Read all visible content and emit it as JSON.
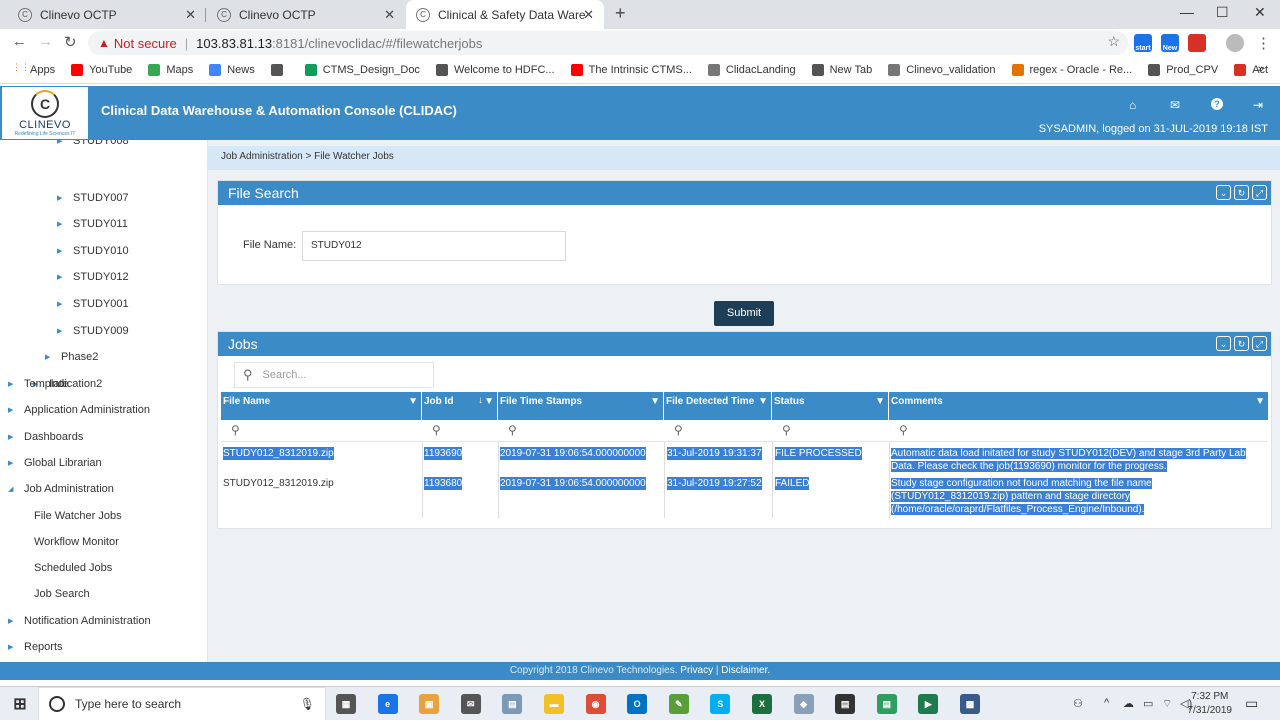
{
  "browser": {
    "tabs": [
      {
        "title": "Clinevo OCTP"
      },
      {
        "title": "Clinevo OCTP"
      },
      {
        "title": "Clinical & Safety Data Warehouse"
      }
    ],
    "new_tab": "+",
    "not_secure": "Not secure",
    "url_host": "103.83.81.13",
    "url_path": ":8181/clinevoclidac/#/filewatcherjobs",
    "extensions": [
      {
        "label": "start",
        "color": "#1a73e8"
      },
      {
        "label": "New",
        "color": "#1a73e8"
      },
      {
        "label": "",
        "color": "#d93025"
      }
    ],
    "bookmarks": [
      {
        "label": "Apps",
        "color": "#e37400"
      },
      {
        "label": "YouTube",
        "color": "#ff0000"
      },
      {
        "label": "Maps",
        "color": "#34a853"
      },
      {
        "label": "News",
        "color": "#4285f4"
      },
      {
        "label": "",
        "color": "#555555"
      },
      {
        "label": "CTMS_Design_Doc",
        "color": "#0f9d58"
      },
      {
        "label": "Welcome to HDFC...",
        "color": "#555555"
      },
      {
        "label": "The Intrinsic CTMS...",
        "color": "#ff0000"
      },
      {
        "label": "ClidacLanding",
        "color": "#777777"
      },
      {
        "label": "New Tab",
        "color": "#555555"
      },
      {
        "label": "Clinevo_validation",
        "color": "#777777"
      },
      {
        "label": "regex - Oracle - Re...",
        "color": "#e37400"
      },
      {
        "label": "Prod_CPV",
        "color": "#555555"
      },
      {
        "label": "Act",
        "color": "#d93025"
      }
    ],
    "bookmark_more": "»"
  },
  "app": {
    "logo_text": "CLINEVO",
    "logo_tagline": "Redefining Life Sciences IT",
    "title": "Clinical Data Warehouse & Automation Console (CLIDAC)",
    "user_info": "SYSADMIN, logged on 31-JUL-2019 19:18 IST"
  },
  "sidebar": {
    "items": [
      {
        "label": "STUDY008",
        "level": 3
      },
      {
        "label": "STUDY007",
        "level": 3
      },
      {
        "label": "STUDY011",
        "level": 3
      },
      {
        "label": "STUDY010",
        "level": 3
      },
      {
        "label": "STUDY012",
        "level": 3
      },
      {
        "label": "STUDY001",
        "level": 3
      },
      {
        "label": "STUDY009",
        "level": 3
      },
      {
        "label": "Phase2",
        "level": 2
      },
      {
        "label": "Indication2",
        "level": 1
      },
      {
        "label": "Template",
        "level": 0
      },
      {
        "label": "Application Administration",
        "level": 0
      },
      {
        "label": "Dashboards",
        "level": 0
      },
      {
        "label": "Global Librarian",
        "level": 0
      },
      {
        "label": "Job Administration",
        "level": 0,
        "expanded": true
      },
      {
        "label": "File Watcher Jobs",
        "level": -1
      },
      {
        "label": "Workflow Monitor",
        "level": -1
      },
      {
        "label": "Scheduled Jobs",
        "level": -1
      },
      {
        "label": "Job Search",
        "level": -1
      },
      {
        "label": "Notification Administration",
        "level": 0
      },
      {
        "label": "Reports",
        "level": 0
      }
    ]
  },
  "breadcrumb": "Job Administration > File Watcher Jobs",
  "file_search": {
    "title": "File Search",
    "file_name_label": "File Name:",
    "file_name_value": "STUDY012",
    "submit_label": "Submit"
  },
  "jobs": {
    "title": "Jobs",
    "search_placeholder": "Search...",
    "columns": [
      "File Name",
      "Job Id",
      "File Time Stamps",
      "File Detected Time",
      "Status",
      "Comments"
    ],
    "rows": [
      {
        "file_name": "STUDY012_8312019.zip",
        "job_id": "1193690",
        "file_time_stamp": "2019-07-31 19:06:54.000000000",
        "file_detected_time": "31-Jul-2019 19:31:37",
        "status": "FILE PROCESSED",
        "comments": [
          "Automatic data load initated for study STUDY012(DEV) and stage 3rd Party Lab",
          "Data. Please check the job(1193690) monitor for the progress."
        ]
      },
      {
        "file_name": "STUDY012_8312019.zip",
        "job_id": "1193680",
        "file_time_stamp": "2019-07-31 19:06:54.000000000",
        "file_detected_time": "31-Jul-2019 19:27:52",
        "status": "FAILED",
        "comments": [
          "Study stage configuration not found matching the file name",
          "(STUDY012_8312019.zip) pattern and stage directory",
          "(/home/oracle/oraprd/Flatfiles_Process_Engine/Inbound)."
        ]
      }
    ]
  },
  "footer": {
    "copyright": "Copyright 2018 Clinevo Technologies.",
    "privacy": "Privacy",
    "sep": "|",
    "disclaimer": "Disclaimer."
  },
  "taskbar": {
    "search_placeholder": "Type here to search",
    "time": "7:32 PM",
    "date": "7/31/2019",
    "apps": [
      {
        "name": "task-view",
        "color": "#555555",
        "glyph": "▦"
      },
      {
        "name": "edge",
        "color": "#1a73e8",
        "glyph": "e"
      },
      {
        "name": "store",
        "color": "#e8a33d",
        "glyph": "▣"
      },
      {
        "name": "notes",
        "color": "#555555",
        "glyph": "✉"
      },
      {
        "name": "db",
        "color": "#7a9ab8",
        "glyph": "▤"
      },
      {
        "name": "explorer",
        "color": "#f2c029",
        "glyph": "▬"
      },
      {
        "name": "chrome",
        "color": "#dd4b39",
        "glyph": "◉"
      },
      {
        "name": "outlook",
        "color": "#0072c6",
        "glyph": "O"
      },
      {
        "name": "notepad",
        "color": "#5a9e3a",
        "glyph": "✎"
      },
      {
        "name": "skype",
        "color": "#00aff0",
        "glyph": "S"
      },
      {
        "name": "excel",
        "color": "#1d6f42",
        "glyph": "X"
      },
      {
        "name": "tool1",
        "color": "#8aa0b8",
        "glyph": "◆"
      },
      {
        "name": "tool2",
        "color": "#333333",
        "glyph": "▤"
      },
      {
        "name": "tool3",
        "color": "#2e9d5e",
        "glyph": "▤"
      },
      {
        "name": "tool4",
        "color": "#1f7a4e",
        "glyph": "▶"
      },
      {
        "name": "tool5",
        "color": "#3a5a8a",
        "glyph": "▩"
      }
    ]
  },
  "colors": {
    "header_blue": "#3b8bc7",
    "selection": "#3a81d6",
    "submit_bg": "#1d3e56"
  }
}
